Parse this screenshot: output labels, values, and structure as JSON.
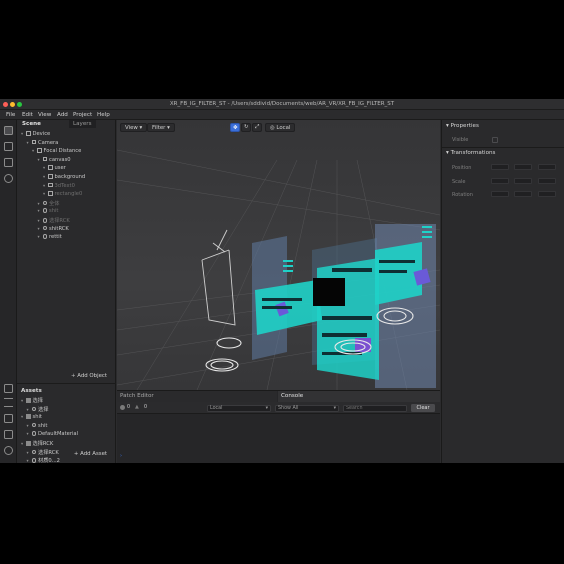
{
  "window": {
    "title": "XR_FB_IG_FILTER_ST - /Users/sddivid/Documents/web/AR_VR/XR_FB_IG_FILTER_ST"
  },
  "menu": [
    "File",
    "Edit",
    "View",
    "Add",
    "Project",
    "Help"
  ],
  "scene_panel": {
    "tabs": [
      "Scene",
      "Layers"
    ],
    "tree": [
      {
        "label": "Device",
        "depth": 0,
        "icon": "device",
        "dim": false
      },
      {
        "label": "Camera",
        "depth": 1,
        "icon": "camera",
        "dim": false
      },
      {
        "label": "Focal Distance",
        "depth": 2,
        "icon": "focal",
        "dim": false
      },
      {
        "label": "canvas0",
        "depth": 3,
        "icon": "canvas",
        "dim": false
      },
      {
        "label": "user",
        "depth": 4,
        "icon": "image",
        "dim": false
      },
      {
        "label": "background",
        "depth": 4,
        "icon": "image",
        "dim": false
      },
      {
        "label": "3dText0",
        "depth": 4,
        "icon": "text",
        "dim": true
      },
      {
        "label": "rectangle0",
        "depth": 4,
        "icon": "rect",
        "dim": true
      },
      {
        "label": "全体",
        "depth": 3,
        "icon": "object",
        "dim": true
      },
      {
        "label": "shit",
        "depth": 3,
        "icon": "object",
        "dim": true
      },
      {
        "label": "选择RCK",
        "depth": 3,
        "icon": "object",
        "dim": true
      },
      {
        "label": "shitRCK",
        "depth": 3,
        "icon": "object",
        "dim": false
      },
      {
        "label": "rettit",
        "depth": 3,
        "icon": "object",
        "dim": false
      }
    ],
    "add_object": "Add Object"
  },
  "assets_panel": {
    "title": "Assets",
    "tree": [
      {
        "label": "选择",
        "depth": 0,
        "icon": "folder"
      },
      {
        "label": "选择",
        "depth": 1,
        "icon": "mesh"
      },
      {
        "label": "shit",
        "depth": 0,
        "icon": "folder"
      },
      {
        "label": "shit",
        "depth": 1,
        "icon": "mesh"
      },
      {
        "label": "DefaultMaterial",
        "depth": 1,
        "icon": "material"
      },
      {
        "label": "选择RCK",
        "depth": 0,
        "icon": "folder"
      },
      {
        "label": "选择RCK",
        "depth": 1,
        "icon": "mesh"
      },
      {
        "label": "&#x6750;&#x8D28;0...2",
        "depth": 1,
        "icon": "material"
      },
      {
        "label": "&#x6750;&#x8D28;0...2",
        "depth": 1,
        "icon": "material"
      },
      {
        "label": "CAPH",
        "depth": 0,
        "icon": "folder"
      },
      {
        "label": "CAPH",
        "depth": 1,
        "icon": "mesh"
      },
      {
        "label": "DefaultMaterial0",
        "depth": 1,
        "icon": "material"
      },
      {
        "label": "shitRCK",
        "depth": 0,
        "icon": "folder"
      },
      {
        "label": "shitRCK",
        "depth": 1,
        "icon": "mesh"
      }
    ],
    "add_asset": "Add Asset"
  },
  "viewport": {
    "view_btn": "View",
    "filter_btn": "Filter",
    "space_btn": "Local",
    "bg_color": "#3c3c3e",
    "teal": "#1fd1c8"
  },
  "console": {
    "tabs": [
      "Patch Editor",
      "Console"
    ],
    "errors": "0",
    "warnings": "0",
    "scope": "Local",
    "filter": "Show All",
    "search_placeholder": "Search",
    "clear": "Clear"
  },
  "properties": {
    "title": "Properties",
    "visible_label": "Visible",
    "transformations_title": "Transformations",
    "rows": [
      "Position",
      "Scale",
      "Rotation"
    ]
  }
}
